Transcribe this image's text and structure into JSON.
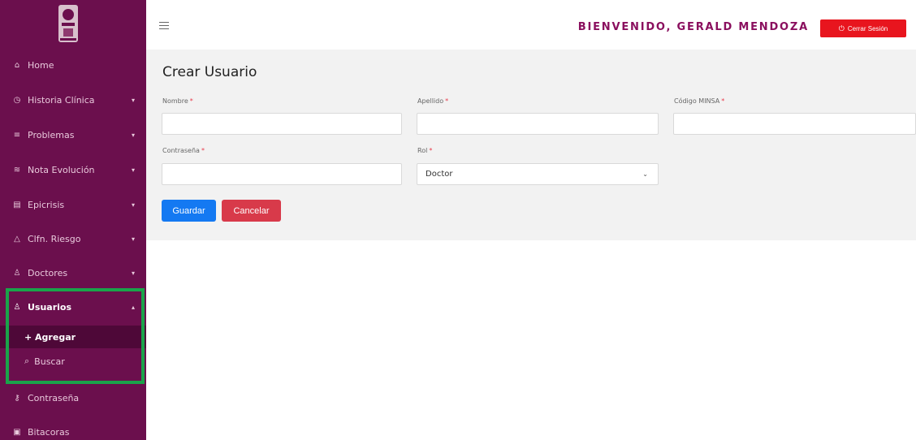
{
  "sidebar": {
    "items": [
      {
        "label": "Home",
        "icon": "home-icon"
      },
      {
        "label": "Historia Clínica",
        "icon": "clipboard-icon"
      },
      {
        "label": "Problemas",
        "icon": "list-icon"
      },
      {
        "label": "Nota Evolución",
        "icon": "notes-icon"
      },
      {
        "label": "Epicrisis",
        "icon": "document-icon"
      },
      {
        "label": "Clfn. Riesgo",
        "icon": "warning-icon"
      },
      {
        "label": "Doctores",
        "icon": "user-icon"
      },
      {
        "label": "Usuarios",
        "icon": "users-icon"
      },
      {
        "label": "Contraseña",
        "icon": "key-icon"
      },
      {
        "label": "Bitacoras",
        "icon": "log-icon"
      }
    ],
    "subitems": [
      {
        "label": "+ Agregar"
      },
      {
        "label": "Buscar"
      }
    ]
  },
  "header": {
    "welcome": "BIENVENIDO, GERALD MENDOZA",
    "logout_label": "Cerrar Sesión"
  },
  "form": {
    "title": "Crear Usuario",
    "fields": {
      "nombre": {
        "label": "Nombre",
        "value": ""
      },
      "apellido": {
        "label": "Apellido",
        "value": ""
      },
      "codigo": {
        "label": "Código MINSA",
        "value": ""
      },
      "contrasena": {
        "label": "Contraseña",
        "value": ""
      },
      "rol": {
        "label": "Rol",
        "value": "Doctor"
      }
    },
    "required_mark": "*",
    "save_label": "Guardar",
    "cancel_label": "Cancelar"
  },
  "colors": {
    "sidebar_bg": "#6b0f4d",
    "accent": "#8a0f5e",
    "save": "#1479f2",
    "cancel": "#d83a4a",
    "logout": "#e8151e",
    "highlight": "#1aa34a"
  }
}
